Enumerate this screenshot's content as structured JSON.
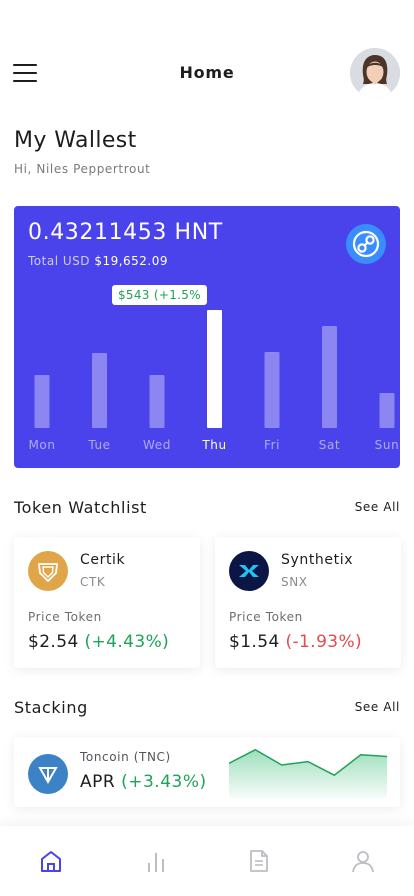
{
  "header": {
    "title": "Home",
    "menu_icon": "menu-icon",
    "avatar_icon": "user-avatar"
  },
  "wallet": {
    "title": "My Wallest",
    "greeting": "Hi, Niles Peppertrout"
  },
  "balance": {
    "amount": "0.43211453 HNT",
    "total_label": "Total USD",
    "total_value": "$19,652.09",
    "token_icon": "helium-icon",
    "accent_color": "#4a42ea"
  },
  "chart_data": {
    "type": "bar",
    "categories": [
      "Mon",
      "Tue",
      "Wed",
      "Thu",
      "Fri",
      "Sat",
      "Sun"
    ],
    "values": [
      53,
      75,
      53,
      118,
      76,
      102,
      35
    ],
    "highlight_index": 3,
    "tooltip": "$543 (+1.5%",
    "colors": {
      "bar": "#8b86f2",
      "highlight": "#ffffff"
    }
  },
  "watchlist": {
    "title": "Token Watchlist",
    "see_all": "See All",
    "items": [
      {
        "name": "Certik",
        "symbol": "CTK",
        "price_label": "Price Token",
        "price": "$2.54",
        "change": "(+4.43%)",
        "icon": "certik-icon",
        "icon_color": "#e0a548"
      },
      {
        "name": "Synthetix",
        "symbol": "SNX",
        "price_label": "Price Token",
        "price": "$1.54",
        "change": "(-1.93%)",
        "icon": "synthetix-icon",
        "icon_color": "#0b1646"
      }
    ]
  },
  "stacking": {
    "title": "Stacking",
    "see_all": "See All",
    "token_name": "Toncoin (TNC)",
    "apr_label": "APR",
    "apr_change": "(+3.43%)",
    "icon": "toncoin-icon",
    "sparkline": [
      42,
      58,
      40,
      44,
      28,
      52,
      50
    ]
  },
  "colors": {
    "positive": "#1fa25a",
    "negative": "#e44a4a",
    "nav_active": "#4a42ea",
    "nav_inactive": "#bdbdc2"
  },
  "nav": {
    "items": [
      {
        "icon": "home-icon",
        "active": true
      },
      {
        "icon": "bar-chart-icon",
        "active": false
      },
      {
        "icon": "document-icon",
        "active": false
      },
      {
        "icon": "profile-icon",
        "active": false
      }
    ]
  }
}
